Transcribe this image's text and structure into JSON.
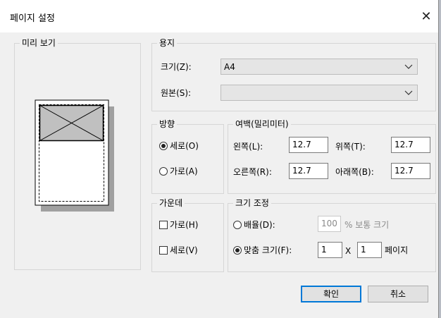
{
  "dialog": {
    "title": "페이지 설정",
    "close_symbol": "✕"
  },
  "preview": {
    "label": "미리 보기"
  },
  "paper": {
    "label": "용지",
    "size_label": "크기(Z):",
    "size_value": "A4",
    "source_label": "원본(S):",
    "source_value": ""
  },
  "orientation": {
    "label": "방향",
    "portrait_label": "세로(O)",
    "landscape_label": "가로(A)",
    "selected": "portrait"
  },
  "margins": {
    "label": "여백(밀리미터)",
    "left_label": "왼쪽(L):",
    "left_value": "12.7",
    "top_label": "위쪽(T):",
    "top_value": "12.7",
    "right_label": "오른쪽(R):",
    "right_value": "12.7",
    "bottom_label": "아래쪽(B):",
    "bottom_value": "12.7"
  },
  "centering": {
    "label": "가운데",
    "horizontal_label": "가로(H)",
    "vertical_label": "세로(V)"
  },
  "scaling": {
    "label": "크기 조정",
    "adjust_label": "배율(D):",
    "adjust_value": "100",
    "adjust_suffix": "% 보통 크기",
    "fit_label": "맞춤 크기(F):",
    "fit_wide_value": "1",
    "fit_x_label": "X",
    "fit_tall_value": "1",
    "fit_suffix": "페이지",
    "selected": "fit"
  },
  "buttons": {
    "ok": "확인",
    "cancel": "취소"
  },
  "colors": {
    "accent": "#0078d7",
    "dialog_bg": "#f0f0f0",
    "preview_image": "#c0c0c0"
  }
}
